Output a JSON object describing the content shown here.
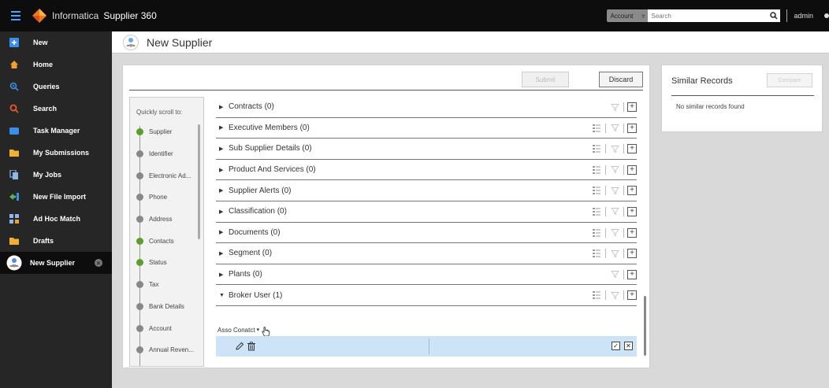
{
  "topbar": {
    "brand": "Informatica",
    "product": "Supplier 360",
    "account_label": "Account",
    "search_placeholder": "Search",
    "user": "admin"
  },
  "sidebar": {
    "items": [
      {
        "label": "New",
        "icon": "plus-icon",
        "color": "#3b8fe8"
      },
      {
        "label": "Home",
        "icon": "home-icon",
        "color": "#f0a030"
      },
      {
        "label": "Queries",
        "icon": "queries-icon",
        "color": "#3b8fe8"
      },
      {
        "label": "Search",
        "icon": "search-icon",
        "color": "#e85a2c"
      },
      {
        "label": "Task Manager",
        "icon": "task-manager-icon",
        "color": "#3b8fe8"
      },
      {
        "label": "My Submissions",
        "icon": "folder-icon",
        "color": "#f0b030"
      },
      {
        "label": "My Jobs",
        "icon": "jobs-icon",
        "color": "#8fb8e8"
      },
      {
        "label": "New File Import",
        "icon": "import-icon",
        "color": "#5cb85c"
      },
      {
        "label": "Ad Hoc Match",
        "icon": "match-icon",
        "color": "#8fb8e8"
      },
      {
        "label": "Drafts",
        "icon": "drafts-folder-icon",
        "color": "#f0b030"
      },
      {
        "label": "New Supplier",
        "icon": "supplier-icon",
        "color": "#4a90e2",
        "active": true
      }
    ]
  },
  "page": {
    "title": "New Supplier"
  },
  "actions": {
    "submit": "Submit",
    "discard": "Discard"
  },
  "scroll_nav": {
    "title": "Quickly scroll to:",
    "items": [
      {
        "label": "Supplier",
        "status": "green"
      },
      {
        "label": "Identifier",
        "status": "gray"
      },
      {
        "label": "Electronic Ad...",
        "status": "gray"
      },
      {
        "label": "Phone",
        "status": "gray"
      },
      {
        "label": "Address",
        "status": "gray"
      },
      {
        "label": "Contacts",
        "status": "green"
      },
      {
        "label": "Status",
        "status": "green"
      },
      {
        "label": "Tax",
        "status": "gray"
      },
      {
        "label": "Bank Details",
        "status": "gray"
      },
      {
        "label": "Account",
        "status": "gray"
      },
      {
        "label": "Annual Reven...",
        "status": "gray"
      }
    ]
  },
  "sections": [
    {
      "label": "Contracts (0)",
      "expanded": false,
      "has_list": false
    },
    {
      "label": "Executive Members (0)",
      "expanded": false,
      "has_list": true
    },
    {
      "label": "Sub Supplier Details (0)",
      "expanded": false,
      "has_list": true
    },
    {
      "label": "Product And Services (0)",
      "expanded": false,
      "has_list": true
    },
    {
      "label": "Supplier Alerts (0)",
      "expanded": false,
      "has_list": true
    },
    {
      "label": "Classification (0)",
      "expanded": false,
      "has_list": true
    },
    {
      "label": "Documents (0)",
      "expanded": false,
      "has_list": true
    },
    {
      "label": "Segment (0)",
      "expanded": false,
      "has_list": true
    },
    {
      "label": "Plants (0)",
      "expanded": false,
      "has_list": false
    },
    {
      "label": "Broker User (1)",
      "expanded": true,
      "has_list": true
    }
  ],
  "broker_user": {
    "column_label": "Asso Conatct"
  },
  "similar": {
    "title": "Similar Records",
    "button": "Compare",
    "empty": "No similar records found"
  }
}
